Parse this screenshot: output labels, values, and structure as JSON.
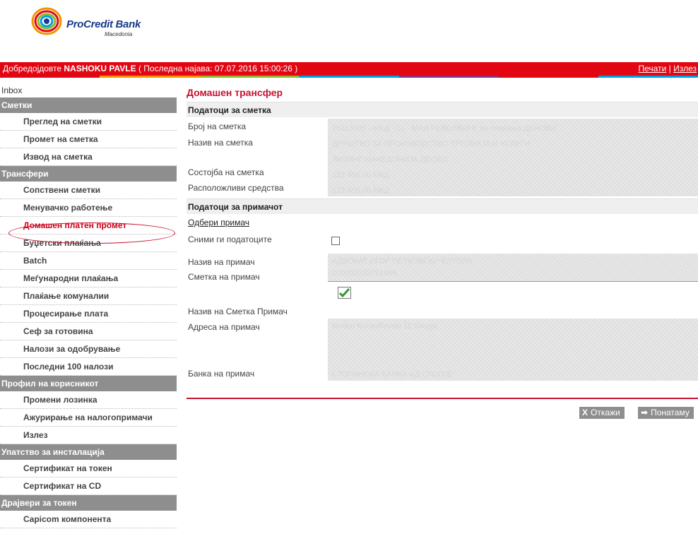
{
  "logo": {
    "brand": "ProCredit Bank",
    "sub": "Macedonia"
  },
  "topbar": {
    "welcome": "Добредојдовте ",
    "user": "NASHOKU PAVLE",
    "last_login": " ( Последна најава: 07.07.2016 15:00:26 )",
    "print_link": "Печати",
    "separator": " | ",
    "logout_link": "Излез"
  },
  "stripe_colors": [
    "#e20613",
    "#f29400",
    "#8cb92b",
    "#009ee0",
    "#8e2c83",
    "#e20613",
    "#009ee0"
  ],
  "sidebar": {
    "inbox": "Inbox",
    "sections": [
      {
        "title": "Сметки",
        "items": [
          "Преглед на сметки",
          "Промет на сметка",
          "Извод на сметка"
        ]
      },
      {
        "title": "Трансфери",
        "items": [
          "Сопствени сметки",
          "Менувачко работење",
          "Домашен платен промет",
          "Буџетски плаќања",
          "Batch",
          "Меѓународни плаќања",
          "Плаќање комуналии",
          "Процесирање плата",
          "Сеф за готовина",
          "Налози за одобрување",
          "Последни 100 налози"
        ]
      },
      {
        "title": "Профил на корисникот",
        "items": [
          "Промени лозинка",
          "Ажурирање на налогопримачи",
          "Излез"
        ]
      },
      {
        "title": "Упатство за инсталација",
        "items": [
          "Сертификат на токен",
          "Сертификат на CD"
        ]
      },
      {
        "title": "Драјвери за токен",
        "items": [
          "Capicom компонента"
        ]
      }
    ],
    "active": "Домашен платен промет"
  },
  "main": {
    "title": "Домашен трансфер",
    "account_section": "Податоци за сметка",
    "account_number_label": "Број на сметка",
    "account_name_label": "Назив на сметка",
    "balance_label": "Состојба на сметка",
    "available_label": "Расположливи средства",
    "account_number_value": "75113605 - МКД - 01 - МАЛ РЕВОЛВИНГ за плаќања ДЕНОВИ",
    "account_name_value": "ДРУШТВО ЗА ПРОИЗВОДСТВО ТРГОВИЈА И УСЛУГИ",
    "account_name_value2": "ЛИЗИНГ МАКЕДОНИЈА ДООЕЛ",
    "balance_value": "123 456,00 МКД",
    "available_value": "123 456,00 МКД",
    "recipient_section": "Податоци за примачот",
    "choose_recipient": "Одбери примач",
    "save_data_label": "Сними ги податоците",
    "recipient_name_label": "Назив на примач",
    "recipient_account_label": "Сметка на примач",
    "recipient_name_value": "АДВОКАТ ИГОР ПЕТКОВСКИ ЕЛТОЛА",
    "recipient_account_value": "200002335701966",
    "recipient_acc_name_label": "Назив на Сметка Примач",
    "recipient_address_label": "Адреса на примач",
    "recipient_address_value": "Ilinden Karanfilovski 11 Skopje",
    "recipient_bank_label": "Банка на примач",
    "recipient_bank_value": "СТОПАНСКА БАНКА АД СКОПЈЕ",
    "cancel_button": "Откажи",
    "next_button": "Понатаму"
  }
}
